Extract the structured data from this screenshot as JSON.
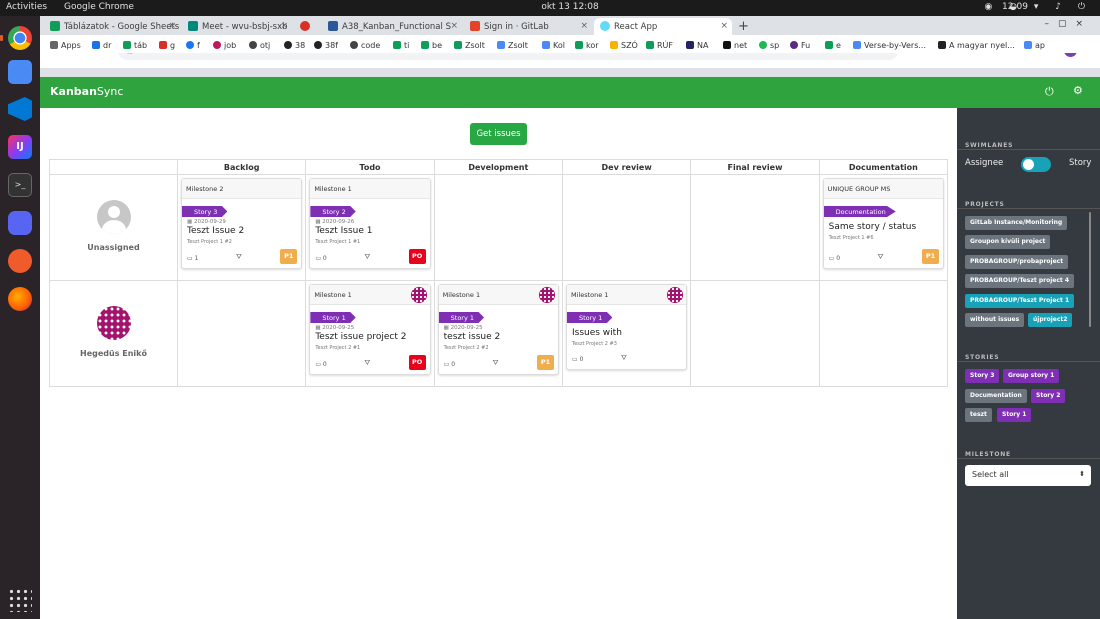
{
  "system": {
    "activities": "Activities",
    "app": "Google Chrome",
    "clock": "okt 13  12:08",
    "tray_time": "12:09"
  },
  "browser": {
    "tabs": [
      {
        "label": "Táblázatok - Google Sheets",
        "color": "#0f9d58"
      },
      {
        "label": "Meet - wvu-bsbj-sxb",
        "color": "#00897b"
      },
      {
        "label": "",
        "color": "#d93025"
      },
      {
        "label": "A38_Kanban_Functional S",
        "color": "#2b579a"
      },
      {
        "label": "Sign in · GitLab",
        "color": "#e24329"
      },
      {
        "label": "React App",
        "color": "#61dafb"
      }
    ],
    "url": "localhost:3000",
    "bookmarks": [
      "Apps",
      "dr",
      "táb",
      "g",
      "f",
      "job",
      "otj",
      "38",
      "38f",
      "code",
      "ti",
      "be",
      "Zsolt",
      "Zsolt",
      "Kol",
      "kor",
      "SZÓ",
      "RÚF",
      "NA",
      "net",
      "sp",
      "Fu",
      "e",
      "Verse-by-Vers...",
      "A magyar nyel...",
      "ap"
    ],
    "profile_initial": "M"
  },
  "app": {
    "brand_bold": "Kanban",
    "brand_rest": "Sync",
    "get_issues": "Get issues"
  },
  "columns": [
    "Backlog",
    "Todo",
    "Development",
    "Dev review",
    "Final review",
    "Documentation"
  ],
  "lanes": [
    {
      "name": "Unassigned"
    },
    {
      "name": "Hegedüs Enikő"
    }
  ],
  "cards": {
    "u_backlog": {
      "milestone": "Milestone 2",
      "story": "Story 3",
      "date": "2020-09-29",
      "title": "Teszt Issue 2",
      "project": "Teszt Project 1 #2",
      "comments": "1",
      "priority": "P1"
    },
    "u_todo": {
      "milestone": "Milestone 1",
      "story": "Story 2",
      "date": "2020-09-26",
      "title": "Teszt Issue 1",
      "project": "Teszt Project 1 #1",
      "comments": "0",
      "priority": "PO"
    },
    "u_doc": {
      "milestone": "UNIQUE GROUP MS",
      "story": "Documentation",
      "date": "",
      "title": "Same story / status",
      "project": "Teszt Project 1 #6",
      "comments": "0",
      "priority": "P1"
    },
    "h_todo": {
      "milestone": "Milestone 1",
      "story": "Story 1",
      "date": "2020-09-25",
      "title": "Teszt issue project 2",
      "project": "Teszt Project 2 #1",
      "comments": "0",
      "priority": "PO"
    },
    "h_dev": {
      "milestone": "Milestone 1",
      "story": "Story 1",
      "date": "2020-09-25",
      "title": "teszt issue 2",
      "project": "Teszt Project 2 #2",
      "comments": "0",
      "priority": "P1"
    },
    "h_review": {
      "milestone": "Milestone 1",
      "story": "Story 1",
      "date": "",
      "title": "Issues with",
      "project": "Teszt Project 2 #3",
      "comments": "0",
      "priority": ""
    }
  },
  "sidebar": {
    "swimlanes_title": "SWIMLANES",
    "toggle_left": "Assignee",
    "toggle_right": "Story",
    "projects_title": "PROJECTS",
    "projects": [
      "GitLab Instance/Monitoring",
      "Groupon kívüli project",
      "PROBAGROUP/probaproject",
      "PROBAGROUP/Teszt project 4",
      "PROBAGROUP/Teszt Project 1",
      "without issues",
      "újproject2"
    ],
    "stories_title": "STORIES",
    "stories": [
      "Story 3",
      "Group story 1",
      "Documentation",
      "Story 2",
      "teszt",
      "Story 1"
    ],
    "milestone_title": "MILESTONE",
    "milestone_value": "Select all"
  },
  "colors": {
    "header_green": "#2fa33e",
    "story_purple": "#7e2fb3",
    "priority_red": "#e8001c",
    "priority_orange": "#f0ad4e",
    "sidebar_bg": "#343a40",
    "teal": "#17a2b8"
  }
}
